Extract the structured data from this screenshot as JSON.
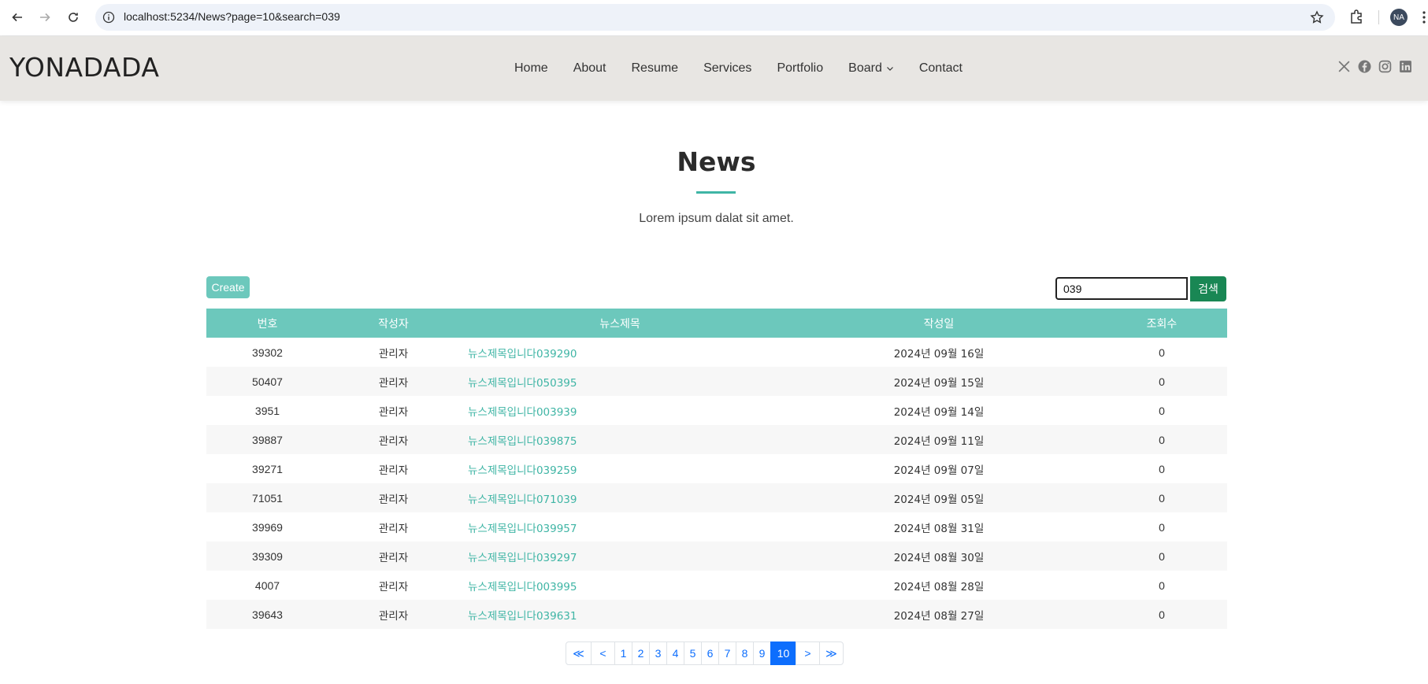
{
  "browser": {
    "url_host": "localhost",
    "url_rest": ":5234/News?page=10&search=039",
    "profile_initials": "NA"
  },
  "site": {
    "logo": "YONADADA",
    "menu": [
      "Home",
      "About",
      "Resume",
      "Services",
      "Portfolio",
      "Board",
      "Contact"
    ],
    "socials": [
      "x-icon",
      "facebook-icon",
      "instagram-icon",
      "linkedin-icon"
    ]
  },
  "section": {
    "title": "News",
    "subtitle": "Lorem ipsum dalat sit amet."
  },
  "toolbar": {
    "create_label": "Create",
    "search_value": "039",
    "search_button": "검색"
  },
  "table": {
    "headers": [
      "번호",
      "작성자",
      "뉴스제목",
      "작성일",
      "조회수"
    ],
    "rows": [
      {
        "no": "39302",
        "writer": "관리자",
        "title": "뉴스제목입니다039290",
        "date": "2024년 09월 16일",
        "views": "0"
      },
      {
        "no": "50407",
        "writer": "관리자",
        "title": "뉴스제목입니다050395",
        "date": "2024년 09월 15일",
        "views": "0"
      },
      {
        "no": "3951",
        "writer": "관리자",
        "title": "뉴스제목입니다003939",
        "date": "2024년 09월 14일",
        "views": "0"
      },
      {
        "no": "39887",
        "writer": "관리자",
        "title": "뉴스제목입니다039875",
        "date": "2024년 09월 11일",
        "views": "0"
      },
      {
        "no": "39271",
        "writer": "관리자",
        "title": "뉴스제목입니다039259",
        "date": "2024년 09월 07일",
        "views": "0"
      },
      {
        "no": "71051",
        "writer": "관리자",
        "title": "뉴스제목입니다071039",
        "date": "2024년 09월 05일",
        "views": "0"
      },
      {
        "no": "39969",
        "writer": "관리자",
        "title": "뉴스제목입니다039957",
        "date": "2024년 08월 31일",
        "views": "0"
      },
      {
        "no": "39309",
        "writer": "관리자",
        "title": "뉴스제목입니다039297",
        "date": "2024년 08월 30일",
        "views": "0"
      },
      {
        "no": "4007",
        "writer": "관리자",
        "title": "뉴스제목입니다003995",
        "date": "2024년 08월 28일",
        "views": "0"
      },
      {
        "no": "39643",
        "writer": "관리자",
        "title": "뉴스제목입니다039631",
        "date": "2024년 08월 27일",
        "views": "0"
      }
    ]
  },
  "pagination": {
    "first": "≪",
    "prev": "<",
    "pages": [
      "1",
      "2",
      "3",
      "4",
      "5",
      "6",
      "7",
      "8",
      "9",
      "10"
    ],
    "active": "10",
    "next": ">",
    "last": "≫"
  },
  "colors": {
    "accent": "#6cc8bc",
    "link": "#3fb5a5",
    "search_button": "#198754",
    "page_active": "#0d6efd"
  }
}
